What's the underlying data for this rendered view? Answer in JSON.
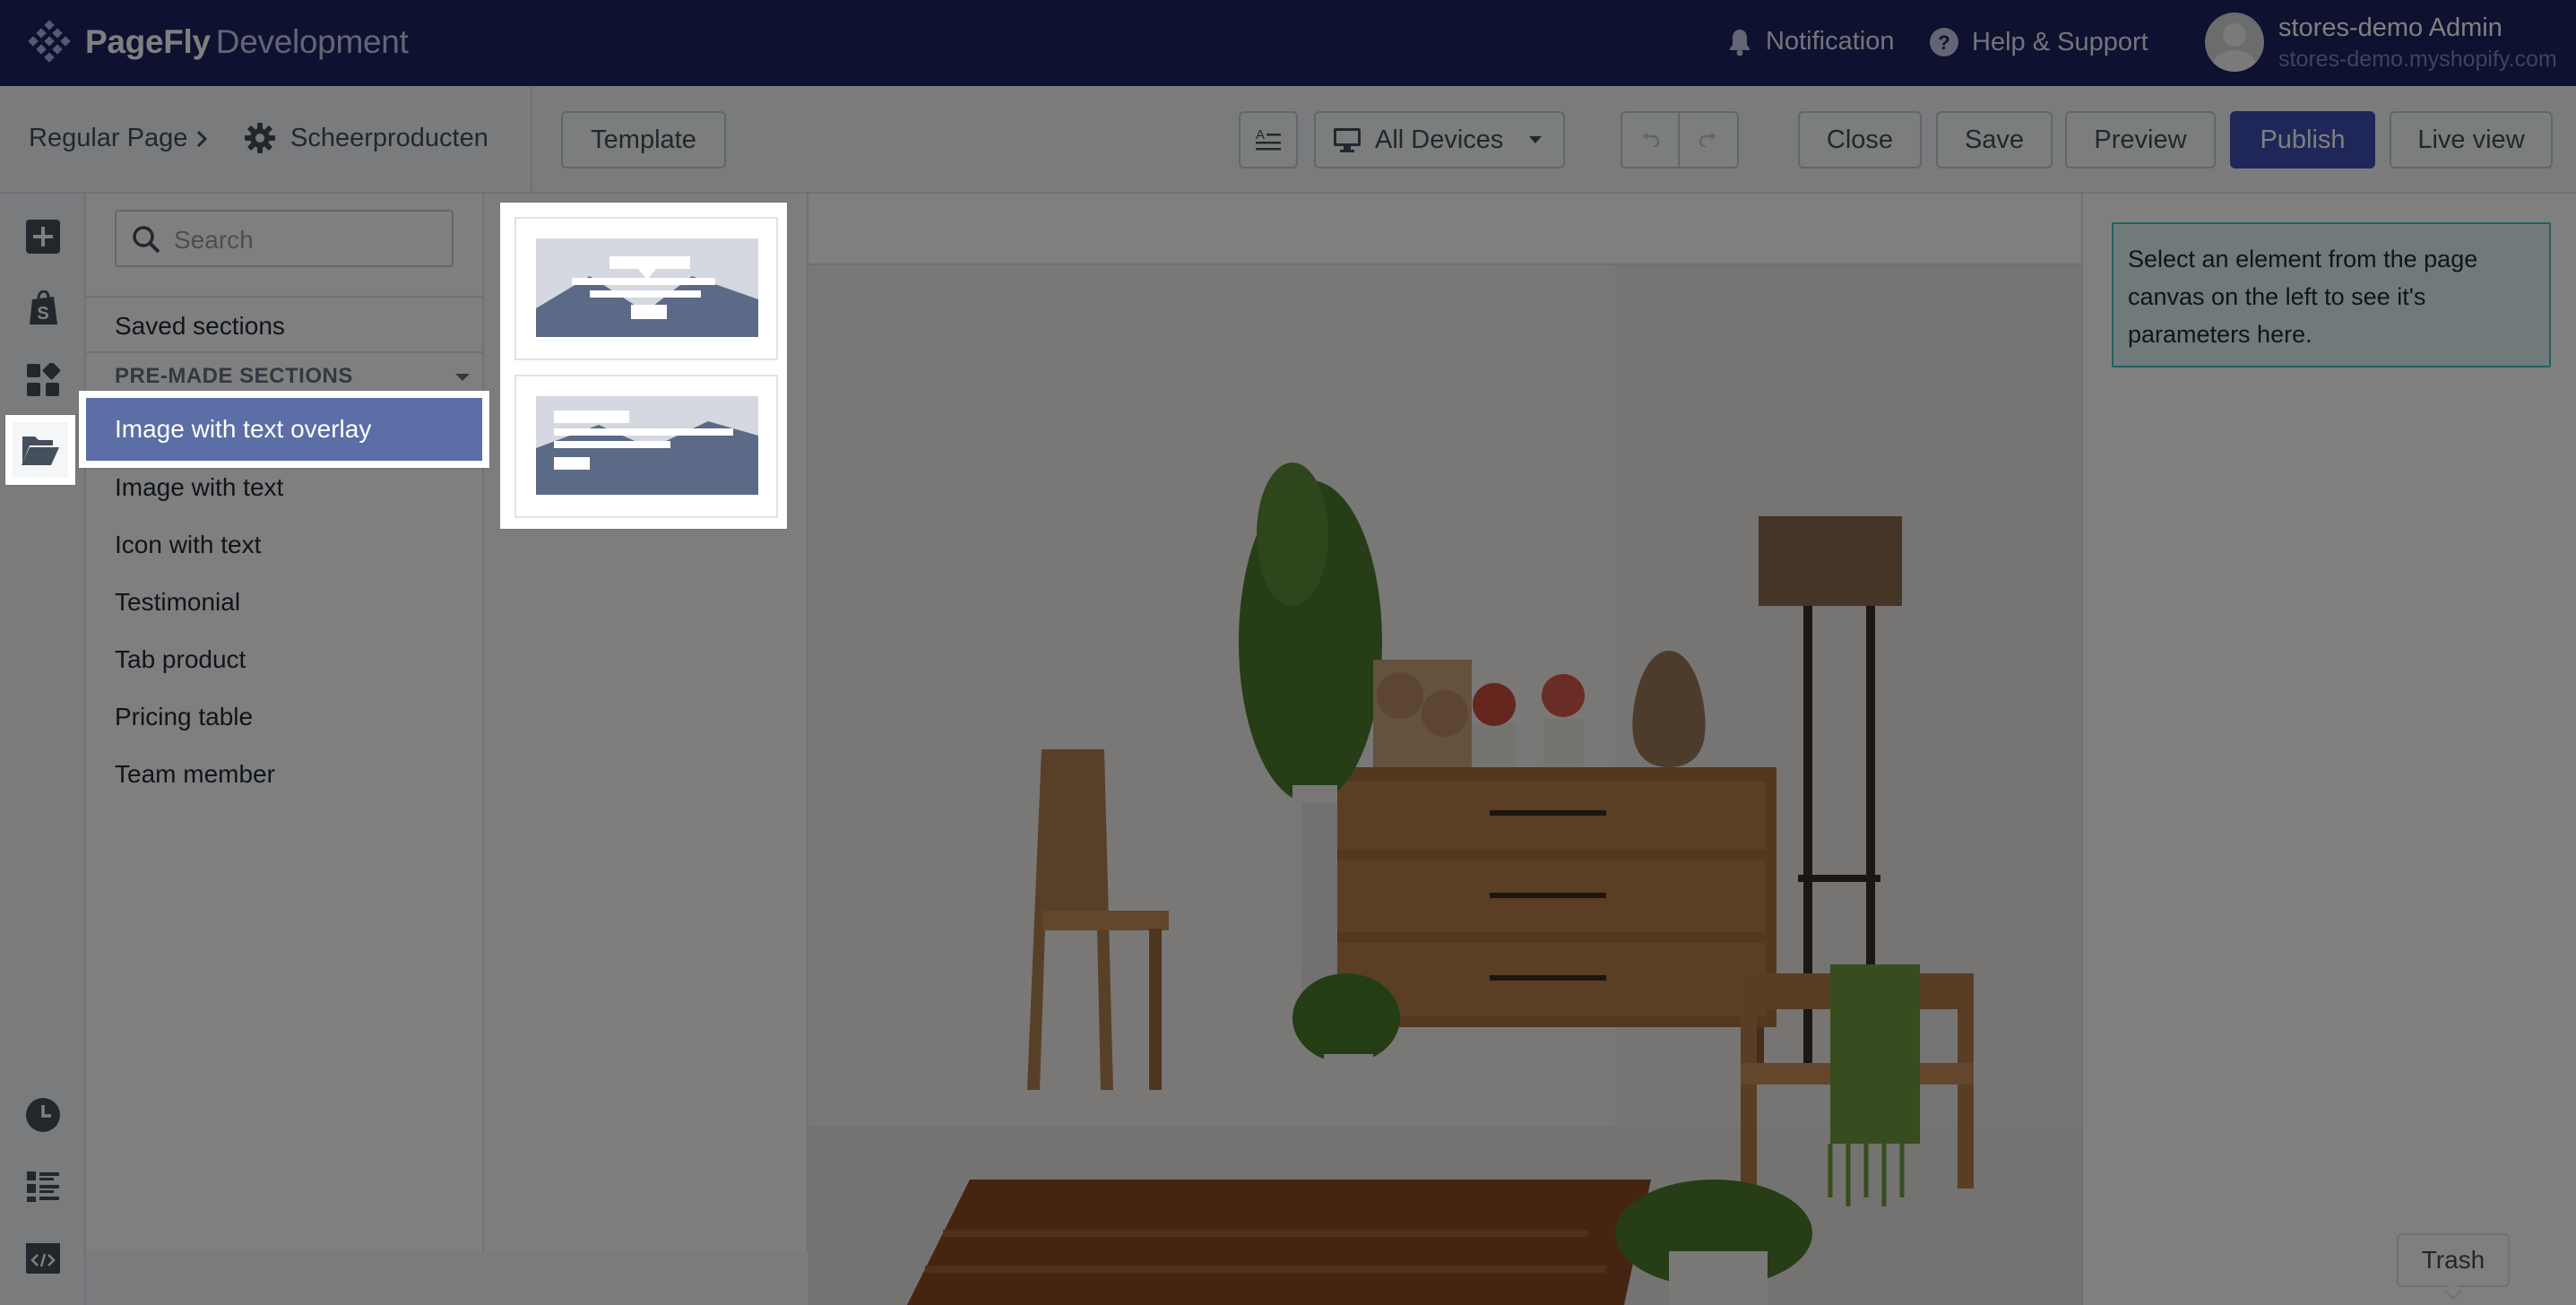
{
  "app": {
    "brand_bold": "PageFly",
    "brand_light": "Development"
  },
  "topbar": {
    "notification_label": "Notification",
    "help_label": "Help & Support",
    "user_name": "stores-demo Admin",
    "user_domain": "stores-demo.myshopify.com"
  },
  "toolbar": {
    "page_type": "Regular Page",
    "page_name": "Scheerproducten",
    "template_label": "Template",
    "device_label": "All Devices",
    "close_label": "Close",
    "save_label": "Save",
    "preview_label": "Preview",
    "publish_label": "Publish",
    "liveview_label": "Live view"
  },
  "panel": {
    "search_placeholder": "Search",
    "saved_sections": "Saved sections",
    "premade_heading": "PRE-MADE SECTIONS",
    "items": [
      {
        "label": "Image with text overlay",
        "active": true
      },
      {
        "label": "Image with text"
      },
      {
        "label": "Icon with text"
      },
      {
        "label": "Testimonial"
      },
      {
        "label": "Tab product"
      },
      {
        "label": "Pricing table"
      },
      {
        "label": "Team member"
      }
    ]
  },
  "inspector": {
    "message": "Select an element from the page canvas on the left to see it's parameters here."
  },
  "trash_label": "Trash",
  "colors": {
    "topbar": "#1c2260",
    "primary": "#3f4eb0",
    "active_item": "#5b6ea6",
    "info_border": "#47c1bf"
  }
}
